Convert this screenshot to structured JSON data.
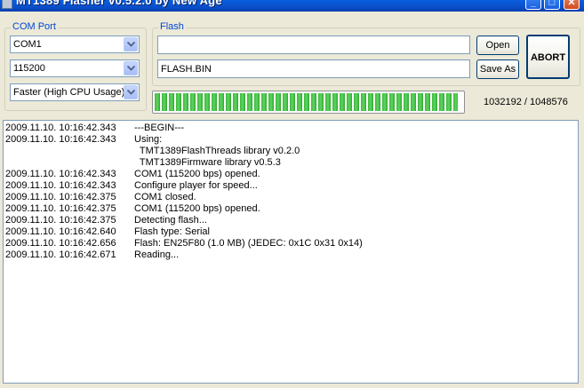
{
  "window": {
    "title": "MT1389 Flasher v0.5.2.0 by New Age",
    "minimize": "_",
    "maximize": "□",
    "close": "✕"
  },
  "com_port": {
    "legend": "COM Port",
    "port": "COM1",
    "baud": "115200",
    "speed": "Faster (High CPU Usage)"
  },
  "flash": {
    "legend": "Flash",
    "path_value": "",
    "file_value": "FLASH.BIN",
    "open_label": "Open",
    "save_as_label": "Save As",
    "abort_label": "ABORT"
  },
  "progress": {
    "fraction": 0.9846,
    "counter": "1032192 / 1048576"
  },
  "log": [
    {
      "ts": "2009.11.10. 10:16:42.343",
      "msg": "---BEGIN---"
    },
    {
      "ts": "2009.11.10. 10:16:42.343",
      "msg": "Using:"
    },
    {
      "ts": "",
      "msg": "  TMT1389FlashThreads library v0.2.0"
    },
    {
      "ts": "",
      "msg": "  TMT1389Firmware library v0.5.3"
    },
    {
      "ts": "2009.11.10. 10:16:42.343",
      "msg": "COM1 (115200 bps) opened."
    },
    {
      "ts": "2009.11.10. 10:16:42.343",
      "msg": "Configure player for speed..."
    },
    {
      "ts": "2009.11.10. 10:16:42.375",
      "msg": "COM1 closed."
    },
    {
      "ts": "2009.11.10. 10:16:42.375",
      "msg": "COM1 (115200 bps) opened."
    },
    {
      "ts": "2009.11.10. 10:16:42.375",
      "msg": "Detecting flash..."
    },
    {
      "ts": "2009.11.10. 10:16:42.640",
      "msg": "Flash type: Serial"
    },
    {
      "ts": "2009.11.10. 10:16:42.656",
      "msg": "Flash: EN25F80 (1.0 MB) (JEDEC: 0x1C 0x31 0x14)"
    },
    {
      "ts": "2009.11.10. 10:16:42.671",
      "msg": "Reading..."
    }
  ]
}
